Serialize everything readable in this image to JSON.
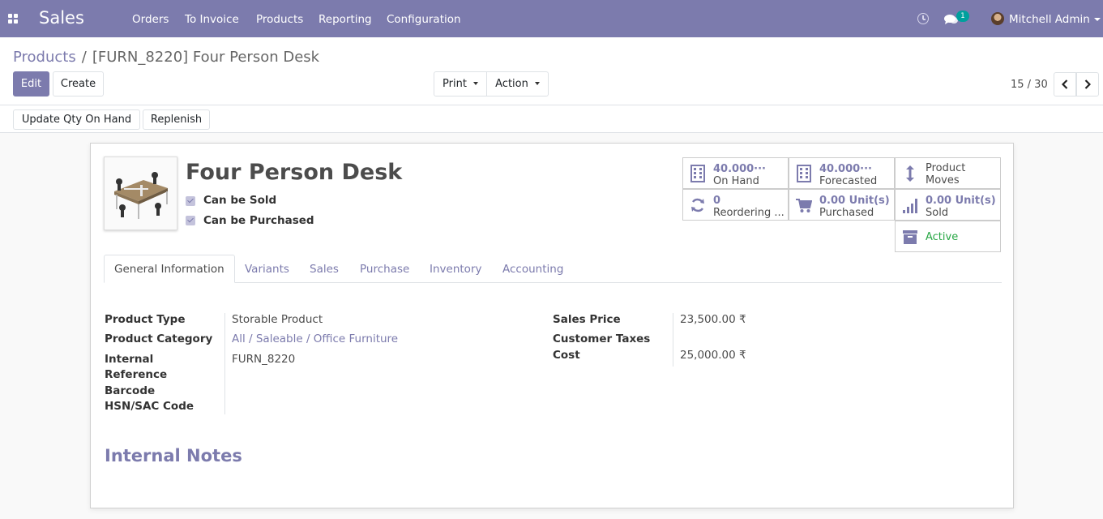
{
  "navbar": {
    "app_name": "Sales",
    "menu": [
      "Orders",
      "To Invoice",
      "Products",
      "Reporting",
      "Configuration"
    ],
    "message_count": "1",
    "user_name": "Mitchell Admin"
  },
  "breadcrumb": {
    "parent": "Products",
    "separator": "/",
    "current": "[FURN_8220] Four Person Desk"
  },
  "buttons": {
    "edit": "Edit",
    "create": "Create",
    "print": "Print",
    "action": "Action",
    "update_qty": "Update Qty On Hand",
    "replenish": "Replenish"
  },
  "pager": {
    "value": "15 / 30"
  },
  "product": {
    "name": "Four Person Desk",
    "can_be_sold_label": "Can be Sold",
    "can_be_purchased_label": "Can be Purchased"
  },
  "smart_buttons": {
    "on_hand_value": "40.000···",
    "on_hand_label": "On Hand",
    "forecasted_value": "40.000···",
    "forecasted_label": "Forecasted",
    "product_moves_line1": "Product",
    "product_moves_line2": "Moves",
    "reordering_value": "0",
    "reordering_label": "Reordering ...",
    "purchased_value": "0.00 Unit(s)",
    "purchased_label": "Purchased",
    "sold_value": "0.00 Unit(s)",
    "sold_label": "Sold",
    "active_label": "Active"
  },
  "tabs": [
    "General Information",
    "Variants",
    "Sales",
    "Purchase",
    "Inventory",
    "Accounting"
  ],
  "general_info": {
    "product_type_label": "Product Type",
    "product_type_value": "Storable Product",
    "product_category_label": "Product Category",
    "product_category_value": "All / Saleable / Office Furniture",
    "internal_ref_label_1": "Internal",
    "internal_ref_label_2": "Reference",
    "internal_ref_value": "FURN_8220",
    "barcode_label": "Barcode",
    "hsn_label": "HSN/SAC Code",
    "sales_price_label": "Sales Price",
    "sales_price_value": "23,500.00 ₹",
    "customer_taxes_label": "Customer Taxes",
    "cost_label": "Cost",
    "cost_value": "25,000.00 ₹"
  },
  "notes": {
    "title": "Internal Notes"
  },
  "colors": {
    "brand": "#7c7bad",
    "active_green": "#28a745",
    "badge": "#00a09d"
  }
}
